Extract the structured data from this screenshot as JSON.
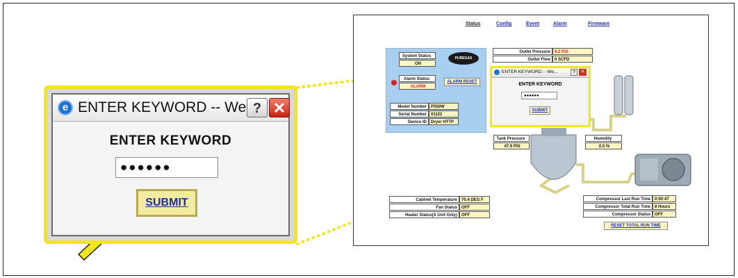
{
  "zoom_dialog": {
    "title": "ENTER KEYWORD -- We...",
    "help_glyph": "?",
    "close_glyph": "✕",
    "heading": "ENTER KEYWORD",
    "password_value": "●●●●●●",
    "submit_label": "SUBMIT"
  },
  "screenshot": {
    "nav": [
      "Status",
      "Config",
      "Event",
      "Alarm",
      "Firmware"
    ],
    "brand_logo": "PUREGAS",
    "system_status": {
      "label": "System Status",
      "value": "ON"
    },
    "alarm_status": {
      "label": "Alarm Status",
      "value": "ALARM"
    },
    "alarm_reset_label": "ALARM RESET",
    "device": [
      {
        "label": "Model Number",
        "value": "P550W"
      },
      {
        "label": "Serial Number",
        "value": "01122"
      },
      {
        "label": "Device ID",
        "value": "Dryer HTTP"
      }
    ],
    "outlet": [
      {
        "label": "Outlet Pressure",
        "value": "6.2 PSI"
      },
      {
        "label": "Outlet Flow",
        "value": "0 SCFD"
      }
    ],
    "mini_dialog": {
      "title": "ENTER KEYWORD -- We...",
      "heading": "ENTER KEYWORD",
      "password_value": "●●●●●●",
      "submit_label": "SUBMIT"
    },
    "tank_pressure": {
      "label": "Tank Pressure",
      "value": "47.9 PSI"
    },
    "humidity": {
      "label": "Humidity",
      "value": "0.0 %"
    },
    "cabinet": [
      {
        "label": "Cabinet Temperature",
        "value": "70.4 DEG F"
      },
      {
        "label": "Fan Status",
        "value": "OFF"
      },
      {
        "label": "Heater Status(X Unit Only)",
        "value": "OFF"
      }
    ],
    "compressor": [
      {
        "label": "Compressor Last Run Time",
        "value": "0:00:47"
      },
      {
        "label": "Compressor Total Run Time",
        "value": "8 Hours"
      },
      {
        "label": "Compressor Status",
        "value": "OFF"
      }
    ],
    "reset_run_time_label": "RESET TOTAL RUN TIME"
  },
  "colors": {
    "highlight_yellow": "#f2e51c",
    "panel_blue": "#a8cff0",
    "value_fill": "#fdf6c4",
    "link_blue": "#1b2ea8",
    "alarm_red": "#e0201a"
  }
}
